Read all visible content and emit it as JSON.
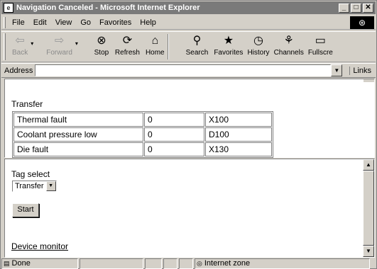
{
  "window": {
    "title": "Navigation Canceled - Microsoft Internet Explorer",
    "controls": {
      "minimize": "_",
      "maximize": "□",
      "close": "✕"
    }
  },
  "menu": [
    "File",
    "Edit",
    "View",
    "Go",
    "Favorites",
    "Help"
  ],
  "toolbar": [
    {
      "label": "Back",
      "icon": "back-arrow-icon",
      "glyph": "⇦",
      "disabled": true,
      "dropdown": true
    },
    {
      "label": "Forward",
      "icon": "forward-arrow-icon",
      "glyph": "⇨",
      "disabled": true,
      "dropdown": true
    },
    {
      "label": "Stop",
      "icon": "stop-icon",
      "glyph": "⊗",
      "disabled": false
    },
    {
      "label": "Refresh",
      "icon": "refresh-icon",
      "glyph": "⟳",
      "disabled": false
    },
    {
      "label": "Home",
      "icon": "home-icon",
      "glyph": "⌂",
      "disabled": false
    },
    {
      "label": "Search",
      "icon": "search-icon",
      "glyph": "⚲",
      "disabled": false
    },
    {
      "label": "Favorites",
      "icon": "favorites-icon",
      "glyph": "★",
      "disabled": false
    },
    {
      "label": "History",
      "icon": "history-icon",
      "glyph": "◷",
      "disabled": false
    },
    {
      "label": "Channels",
      "icon": "channels-icon",
      "glyph": "⚘",
      "disabled": false
    },
    {
      "label": "Fullscre",
      "icon": "fullscreen-icon",
      "glyph": "▭",
      "disabled": false
    }
  ],
  "address": {
    "label": "Address",
    "value": "",
    "links_label": "Links"
  },
  "transfer": {
    "title": "Transfer",
    "rows": [
      [
        "Thermal fault",
        "0",
        "X100"
      ],
      [
        "Coolant pressure low",
        "0",
        "D100"
      ],
      [
        "Die fault",
        "0",
        "X130"
      ]
    ]
  },
  "tag": {
    "label": "Tag select",
    "selected": "Transfer",
    "start_label": "Start",
    "device_link": "Device monitor"
  },
  "status": {
    "text": "Done",
    "zone": "Internet zone"
  }
}
